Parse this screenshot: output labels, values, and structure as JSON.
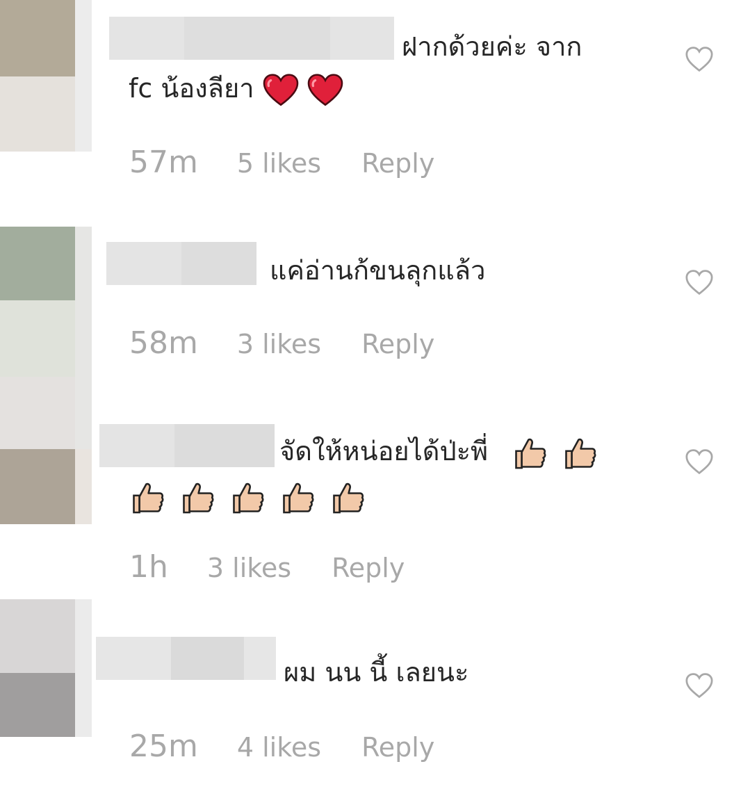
{
  "comments": [
    {
      "text_line1": "ฝากด้วยค่ะ จาก",
      "text_line2": "fc น้องลียา",
      "time": "57m",
      "likes": "5 likes",
      "reply": "Reply",
      "emoji_icons": [
        "red-heart-icon",
        "red-heart-icon"
      ]
    },
    {
      "text_line1": "แค่อ่านก้ขนลุกแล้ว",
      "time": "58m",
      "likes": "3 likes",
      "reply": "Reply"
    },
    {
      "text_line1": "จัดให้หน่อยได้ป่ะพี่",
      "time": "1h",
      "likes": "3 likes",
      "reply": "Reply",
      "emoji_icons": [
        "thumbs-up-icon",
        "thumbs-up-icon",
        "thumbs-up-icon",
        "thumbs-up-icon",
        "thumbs-up-icon",
        "thumbs-up-icon",
        "thumbs-up-icon"
      ]
    },
    {
      "text_line1": "ผม นน นี้ เลยนะ",
      "time": "25m",
      "likes": "4 likes",
      "reply": "Reply"
    }
  ],
  "icons": {
    "like": "heart-outline-icon"
  },
  "colors": {
    "text": "#262626",
    "meta": "#a8a8a8",
    "heart_emoji": "#e0203a",
    "thumb_skin": "#f2c9a9"
  }
}
